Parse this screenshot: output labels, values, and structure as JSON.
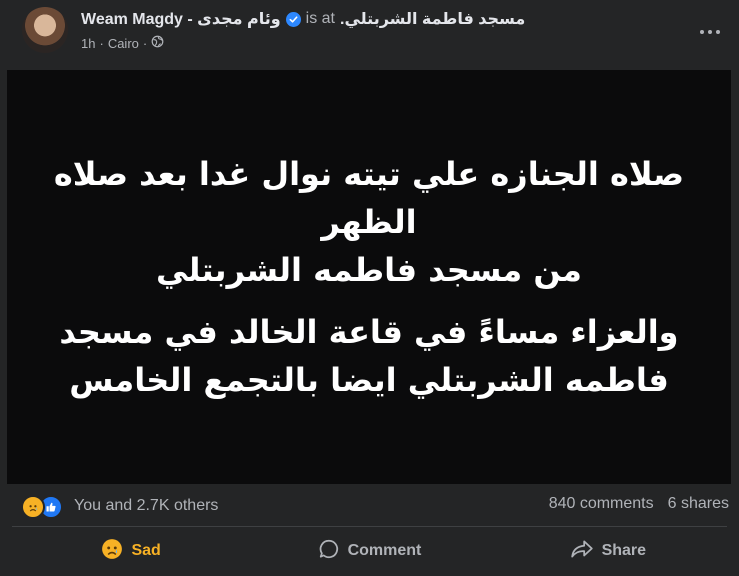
{
  "post": {
    "author": "Weam Magdy - وئام مجدى",
    "is_at": "is at",
    "place": "مسجد فاطمة الشربتلي.",
    "time": "1h",
    "separator": "·",
    "location": "Cairo",
    "body_lines": [
      "صلاه الجنازه علي تيته نوال غدا بعد صلاه",
      "الظهر",
      "من مسجد فاطمه الشربتلي",
      "والعزاء مساءً في قاعة الخالد في مسجد",
      "فاطمه الشربتلي ايضا بالتجمع الخامس"
    ]
  },
  "reactions": {
    "icons": [
      "sad-emoji-icon",
      "thumbs-up-icon"
    ],
    "summary": "You and 2.7K others",
    "comments": "840 comments",
    "shares": "6 shares"
  },
  "actions": {
    "sad_label": "Sad",
    "comment_label": "Comment",
    "share_label": "Share"
  },
  "colors": {
    "background": "#242526",
    "post_body": "#0b0b0c",
    "sad_accent": "#f7b125",
    "like_blue": "#2078f4",
    "secondary_text": "#b0b3b8"
  }
}
